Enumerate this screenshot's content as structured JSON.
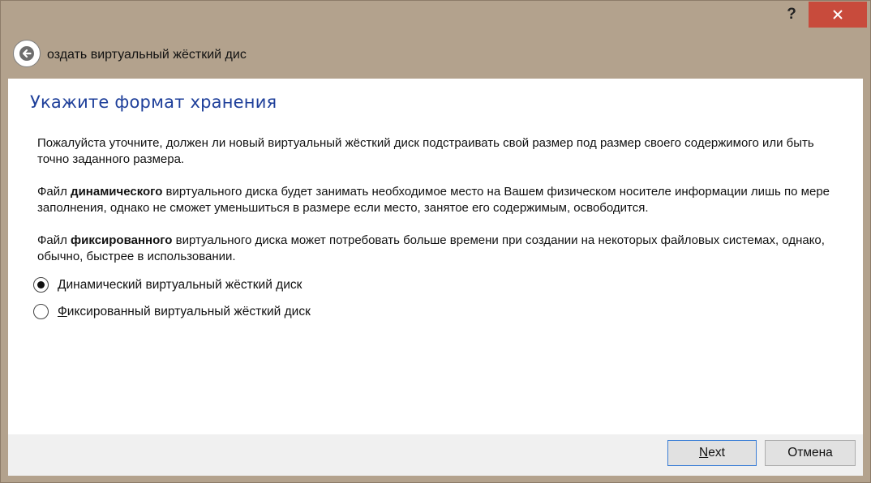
{
  "titlebar": {
    "help_label": "?",
    "close_icon": "close-icon"
  },
  "wizard": {
    "title": "оздать виртуальный жёсткий дис",
    "back_icon": "arrow-left-icon"
  },
  "page": {
    "title": "Укажите формат хранения",
    "intro": "Пожалуйста уточните, должен ли новый виртуальный жёсткий диск подстраивать свой размер под размер своего содержимого или быть точно заданного размера.",
    "dynamic_prefix": "Файл ",
    "dynamic_bold": "динамического",
    "dynamic_rest": " виртуального диска будет занимать необходимое место на Вашем физическом носителе информации лишь по мере заполнения, однако не сможет уменьшиться в размере если место, занятое его содержимым, освободится.",
    "fixed_prefix": "Файл ",
    "fixed_bold": "фиксированного",
    "fixed_rest": " виртуального диска может потребовать больше времени при создании на некоторых файловых системах, однако, обычно, быстрее в использовании."
  },
  "options": [
    {
      "label": "Динамический виртуальный жёсткий диск",
      "selected": true
    },
    {
      "label": "Фиксированный виртуальный жёсткий диск",
      "selected": false
    }
  ],
  "footer": {
    "next_label": "Next",
    "cancel_label": "Отмена"
  },
  "colors": {
    "accent_title": "#1e3f9a",
    "close_button": "#c84b3c",
    "window_frame": "#b3a28d",
    "default_button_border": "#3c7fd6"
  }
}
